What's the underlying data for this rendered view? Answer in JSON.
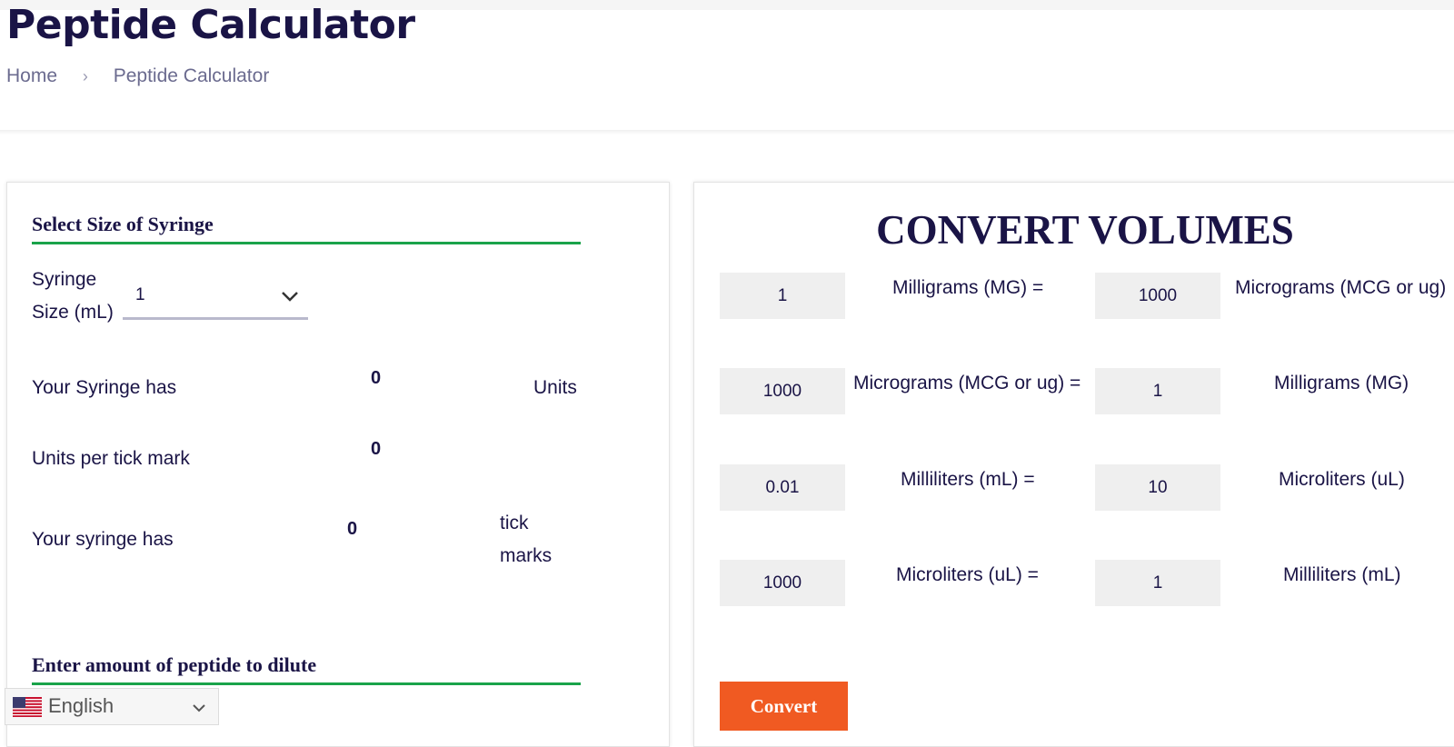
{
  "header": {
    "title": "Peptide Calculator",
    "breadcrumb": {
      "home": "Home",
      "separator": "›",
      "current": "Peptide Calculator"
    }
  },
  "syringe": {
    "heading": "Select Size of Syringe",
    "size_label_line1": "Syringe",
    "size_label_line2": "Size (mL)",
    "size_value": "1",
    "units_label": "Your Syringe has",
    "units_value": "0",
    "units_suffix": "Units",
    "tick_units_label": "Units per tick mark",
    "tick_units_value": "0",
    "tick_count_label": "Your syringe has",
    "tick_count_value": "0",
    "tick_suffix_line1": "tick",
    "tick_suffix_line2": "marks"
  },
  "peptide": {
    "heading": "Enter amount of peptide to dilute"
  },
  "convert": {
    "title": "CONVERT VOLUMES",
    "rows": [
      {
        "from_value": "1",
        "from_unit": "Milligrams (MG) =",
        "to_value": "1000",
        "to_unit": "Micrograms (MCG or ug)"
      },
      {
        "from_value": "1000",
        "from_unit": "Micrograms (MCG or ug) =",
        "to_value": "1",
        "to_unit": "Milligrams (MG)"
      },
      {
        "from_value": "0.01",
        "from_unit": "Milliliters (mL) =",
        "to_value": "10",
        "to_unit": "Microliters (uL)"
      },
      {
        "from_value": "1000",
        "from_unit": "Microliters (uL) =",
        "to_value": "1",
        "to_unit": "Milliliters (mL)"
      }
    ],
    "button_label": "Convert"
  },
  "language": {
    "label": "English",
    "flag_icon": "us-flag-icon"
  },
  "colors": {
    "accent": "#f05a22",
    "heading_rule": "#1aa34a",
    "text": "#1a1446"
  }
}
